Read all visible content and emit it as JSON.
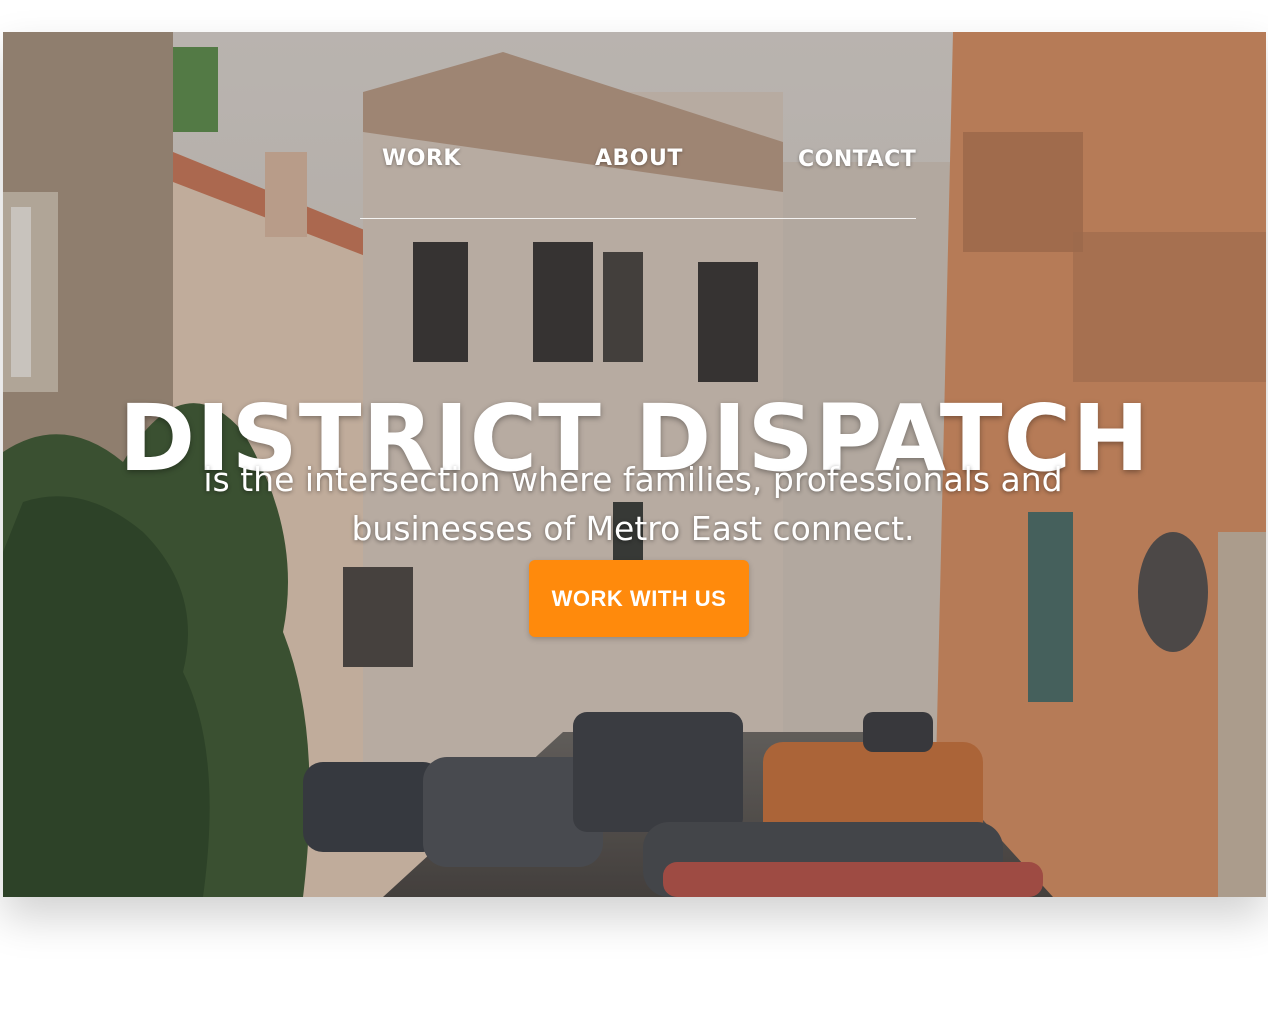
{
  "nav": {
    "items": [
      {
        "label": "WORK"
      },
      {
        "label": "ABOUT"
      },
      {
        "label": "CONTACT"
      }
    ]
  },
  "hero": {
    "title": "DISTRICT DISPATCH",
    "subtitle": "is the intersection where families, professionals and businesses of Metro East connect.",
    "cta_label": "WORK WITH US"
  },
  "colors": {
    "accent": "#ff8a0c",
    "text": "#ffffff"
  },
  "icons": {
    "background": "street-photo"
  }
}
